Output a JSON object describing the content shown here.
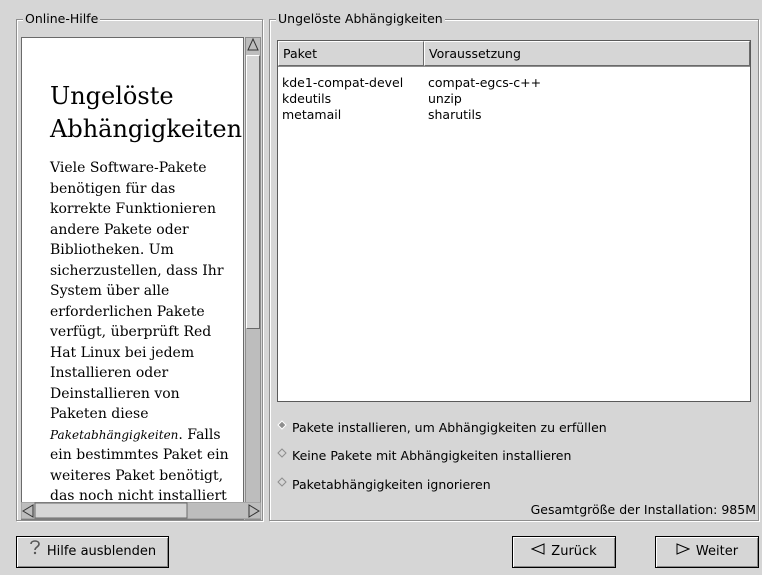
{
  "help_panel": {
    "legend": "Online-Hilfe",
    "heading_line1": "Ungelöste",
    "heading_line2": "Abhängigkeiten",
    "paragraph_before": "Viele Software-Pakete benötigen für das korrekte Funktionieren andere Pakete oder Bibliotheken. Um sicherzustellen, dass Ihr System über alle erforderlichen Pakete verfügt, überprüft Red Hat Linux bei jedem Installieren oder Deinstallieren von Paketen diese",
    "paragraph_em": "Paketabhängigkeiten",
    "paragraph_after": ". Falls ein bestimmtes Paket ein weiteres Paket benötigt, das noch nicht installiert"
  },
  "deps_panel": {
    "legend": "Ungelöste Abhängigkeiten",
    "columns": [
      "Paket",
      "Voraussetzung"
    ],
    "rows": [
      {
        "package": "kde1-compat-devel",
        "requirement": "compat-egcs-c++"
      },
      {
        "package": "kdeutils",
        "requirement": "unzip"
      },
      {
        "package": "metamail",
        "requirement": "sharutils"
      }
    ],
    "options": [
      {
        "label": "Pakete installieren, um Abhängigkeiten zu erfüllen",
        "selected": true
      },
      {
        "label": "Keine Pakete mit Abhängigkeiten installieren",
        "selected": false
      },
      {
        "label": "Paketabhängigkeiten ignorieren",
        "selected": false
      }
    ],
    "total_size": "Gesamtgröße der Installation: 985M"
  },
  "buttons": {
    "hide_help": "Hilfe ausblenden",
    "back": "Zurück",
    "next": "Weiter"
  },
  "icons": {
    "hide_help": "question-mark-icon",
    "back": "left-triangle-icon",
    "next": "right-triangle-icon"
  }
}
